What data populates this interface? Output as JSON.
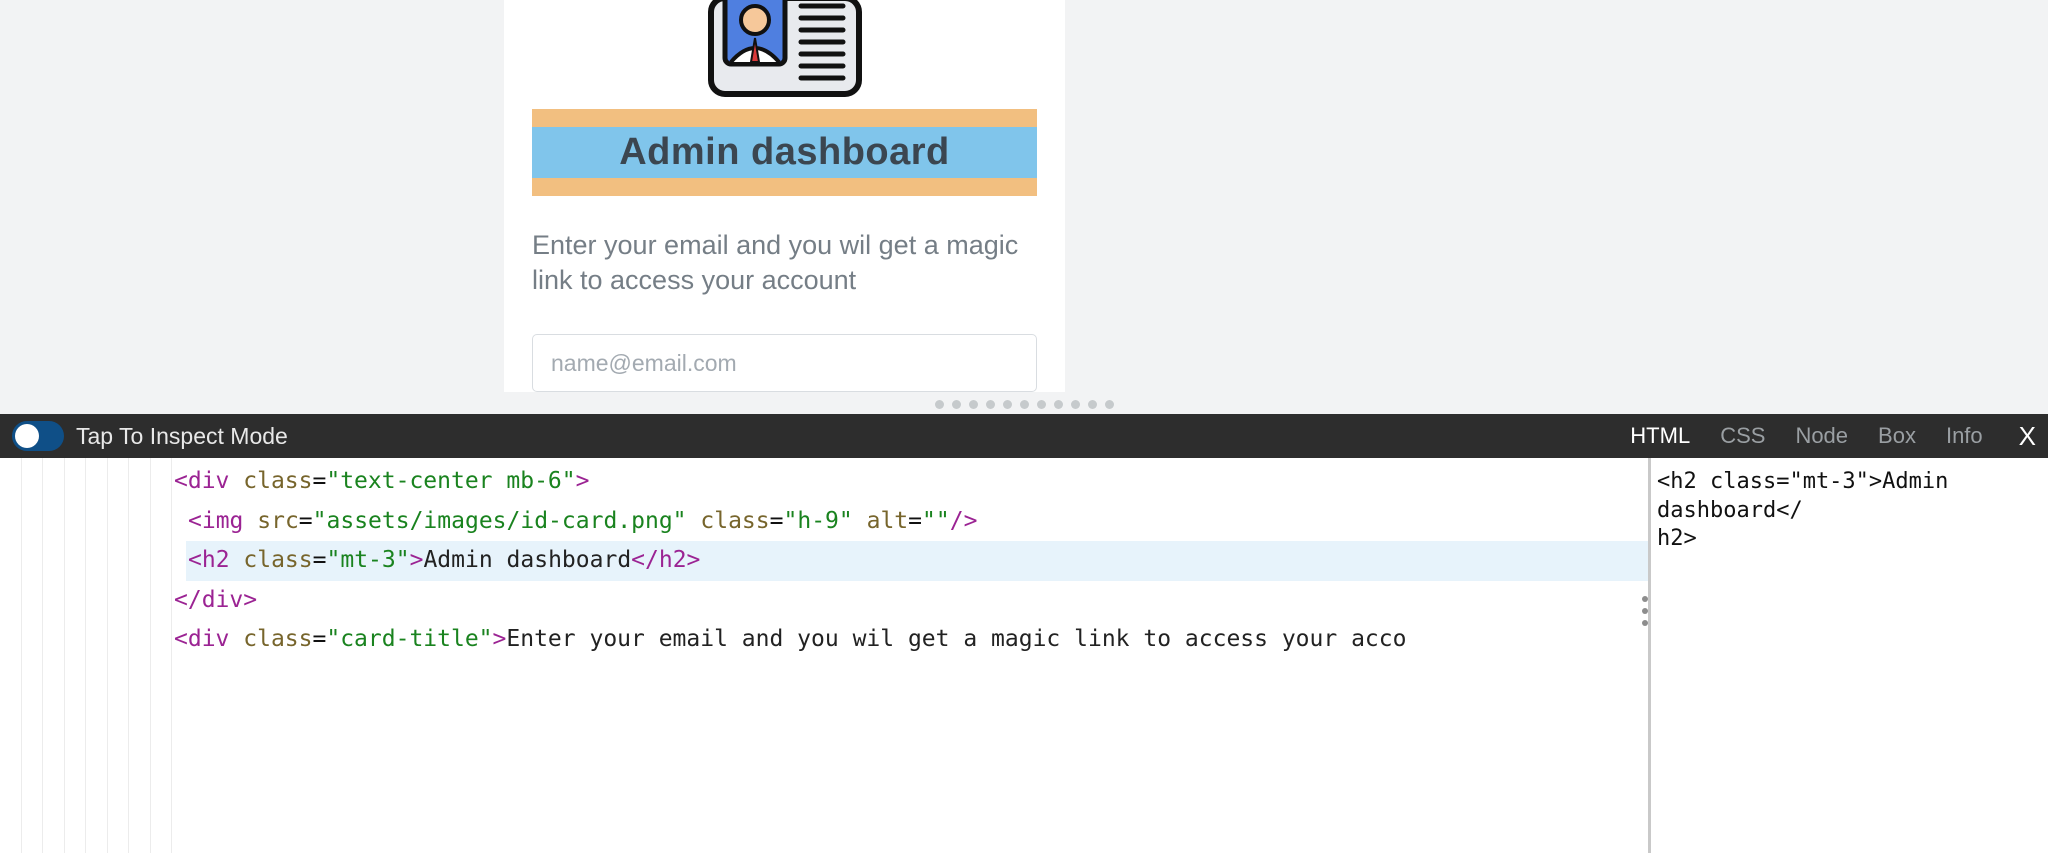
{
  "preview": {
    "title": "Admin dashboard",
    "subtitle": "Enter your email and you wil get a magic link to access your account",
    "emailPlaceholder": "name@email.com"
  },
  "toolbar": {
    "toggleLabel": "Tap To Inspect Mode"
  },
  "tabs": {
    "html": "HTML",
    "css": "CSS",
    "node": "Node",
    "box": "Box",
    "info": "Info",
    "close": "X"
  },
  "code": {
    "l1_open": "<div ",
    "l1_attr": "class",
    "l1_val": "\"text-center mb-6\"",
    "l1_close": ">",
    "l2_open": "<img ",
    "l2_attr1": "src",
    "l2_val1": "\"assets/images/id-card.png\"",
    "l2_attr2": "class",
    "l2_val2": "\"h-9\"",
    "l2_attr3": "alt",
    "l2_val3": "\"\"",
    "l2_close": "/>",
    "l3_open": "<h2 ",
    "l3_attr": "class",
    "l3_val": "\"mt-3\"",
    "l3_mid": ">",
    "l3_text": "Admin dashboard",
    "l3_close": "</h2>",
    "l4": "</div>",
    "l5_open": "<div ",
    "l5_attr": "class",
    "l5_val": "\"card-title\"",
    "l5_mid": ">",
    "l5_text": "Enter your email and you wil get a magic link to access your acco"
  },
  "sidePane": {
    "line1": "<h2 class=\"mt-3\">Admin dashboard</",
    "line2": "h2>"
  }
}
